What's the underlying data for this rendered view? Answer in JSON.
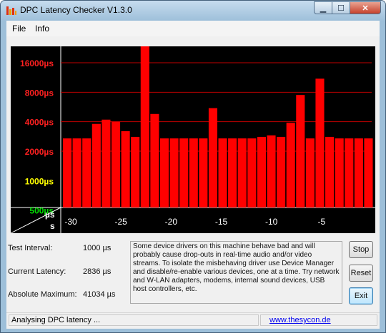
{
  "window": {
    "title": "DPC Latency Checker V1.3.0"
  },
  "menu": {
    "items": [
      "File",
      "Info"
    ]
  },
  "chart_data": {
    "type": "bar",
    "y_axis": {
      "scale": "log",
      "unit": "µs",
      "tick_labels": [
        "16000µs",
        "8000µs",
        "4000µs",
        "2000µs",
        "1000µs",
        "500µs"
      ],
      "tick_colors": [
        "#ff2020",
        "#ff2020",
        "#ff2020",
        "#ff2020",
        "#ffff00",
        "#00e000"
      ]
    },
    "x_axis": {
      "unit": "s",
      "tick_labels": [
        "-30",
        "-25",
        "-20",
        "-15",
        "-10",
        "-5"
      ],
      "range": [
        -31,
        0
      ]
    },
    "corner_labels": {
      "y": "µs",
      "x": "s"
    },
    "bar_color": "#ff0000",
    "grid": true,
    "values": [
      2700,
      2700,
      2700,
      3800,
      4200,
      4000,
      3200,
      2800,
      26000,
      4800,
      2700,
      2700,
      2700,
      2700,
      2700,
      5500,
      2700,
      2700,
      2700,
      2700,
      2800,
      2900,
      2800,
      3900,
      7500,
      2700,
      11000,
      2800,
      2700,
      2700,
      2700,
      2700
    ]
  },
  "stats": {
    "test_interval_label": "Test Interval:",
    "test_interval_value": "1000 µs",
    "current_latency_label": "Current Latency:",
    "current_latency_value": "2836 µs",
    "absolute_maximum_label": "Absolute Maximum:",
    "absolute_maximum_value": "41034 µs"
  },
  "message": "Some device drivers on this machine behave bad and will probably cause drop-outs in real-time audio and/or video streams. To isolate the misbehaving driver use Device Manager and disable/re-enable various devices, one at a time. Try network and W-LAN adapters, modems, internal sound devices, USB host controllers, etc.",
  "buttons": {
    "stop": "Stop",
    "reset": "Reset",
    "exit": "Exit"
  },
  "status": {
    "text": "Analysing DPC latency ...",
    "link": "www.thesycon.de"
  },
  "window_buttons": {
    "minimize": "▁",
    "maximize": "☐",
    "close": "✕"
  }
}
